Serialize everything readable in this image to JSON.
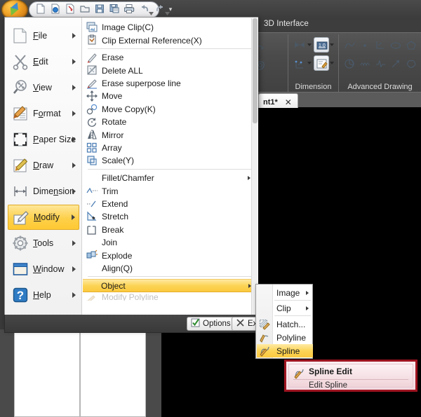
{
  "app": {
    "logo_name": "application-logo",
    "quick_access": [
      {
        "name": "new-file-icon",
        "label": "New"
      },
      {
        "name": "open-image-icon",
        "label": "Open Image"
      },
      {
        "name": "import-icon",
        "label": "Import"
      },
      {
        "name": "open-folder-icon",
        "label": "Open"
      },
      {
        "name": "save-icon",
        "label": "Save"
      },
      {
        "name": "save-as-icon",
        "label": "Save As"
      },
      {
        "name": "print-icon",
        "label": "Print"
      },
      {
        "name": "undo-icon",
        "label": "Undo"
      },
      {
        "name": "redo-icon",
        "label": "Redo"
      }
    ],
    "quick_access_more": "▾"
  },
  "ribbon": {
    "tab_label": "3D Interface",
    "panels": [
      {
        "name": "panel-unnamed",
        "title": ""
      },
      {
        "name": "panel-dimension",
        "title": "Dimension"
      },
      {
        "name": "panel-advanced-drawing",
        "title": "Advanced Drawing"
      }
    ]
  },
  "document_tab": {
    "label": "nt1*",
    "close_label": "✕"
  },
  "menu": {
    "categories": [
      {
        "name": "file",
        "label": "File",
        "pre": "",
        "key": "F",
        "post": "ile",
        "icon": "document-icon",
        "arrow": true,
        "selected": false
      },
      {
        "name": "edit",
        "label": "Edit",
        "pre": "",
        "key": "E",
        "post": "dit",
        "icon": "scissors-icon",
        "arrow": true,
        "selected": false
      },
      {
        "name": "view",
        "label": "View",
        "pre": "",
        "key": "V",
        "post": "iew",
        "icon": "magnifier-icon",
        "arrow": true,
        "selected": false
      },
      {
        "name": "format",
        "label": "Format",
        "pre": "F",
        "key": "o",
        "post": "rmat",
        "icon": "format-brush-icon",
        "arrow": true,
        "selected": false
      },
      {
        "name": "paper-size",
        "label": "Paper Size",
        "pre": "",
        "key": "P",
        "post": "aper Size",
        "icon": "paper-size-icon",
        "arrow": true,
        "selected": false
      },
      {
        "name": "draw",
        "label": "Draw",
        "pre": "",
        "key": "D",
        "post": "raw",
        "icon": "pencil-icon",
        "arrow": true,
        "selected": false
      },
      {
        "name": "dimension",
        "label": "Dimension",
        "pre": "Dime",
        "key": "n",
        "post": "sion",
        "icon": "dimension-icon",
        "arrow": true,
        "selected": false
      },
      {
        "name": "modify",
        "label": "Modify",
        "pre": "",
        "key": "M",
        "post": "odify",
        "icon": "modify-icon",
        "arrow": true,
        "selected": true
      },
      {
        "name": "tools",
        "label": "Tools",
        "pre": "",
        "key": "T",
        "post": "ools",
        "icon": "gear-icon",
        "arrow": true,
        "selected": false
      },
      {
        "name": "window",
        "label": "Window",
        "pre": "",
        "key": "W",
        "post": "indow",
        "icon": "window-icon",
        "arrow": true,
        "selected": false
      },
      {
        "name": "help",
        "label": "Help",
        "pre": "",
        "key": "H",
        "post": "elp",
        "icon": "help-icon",
        "arrow": true,
        "selected": false
      }
    ],
    "items": [
      {
        "name": "image-clip",
        "label": "Image Clip(C)",
        "icon": "image-clip-icon",
        "arrow": false,
        "highlighted": false,
        "sep_after": false
      },
      {
        "name": "clip-external-reference",
        "label": "Clip External Reference(X)",
        "icon": "clip-xref-icon",
        "arrow": false,
        "highlighted": false,
        "sep_after": true
      },
      {
        "name": "erase",
        "label": "Erase",
        "icon": "eraser-icon",
        "arrow": false,
        "highlighted": false,
        "sep_after": false
      },
      {
        "name": "delete-all",
        "label": "Delete ALL",
        "icon": "delete-all-icon",
        "arrow": false,
        "highlighted": false,
        "sep_after": false
      },
      {
        "name": "erase-superpose-line",
        "label": "Erase superpose line",
        "icon": "eraser-line-icon",
        "arrow": false,
        "highlighted": false,
        "sep_after": false
      },
      {
        "name": "move",
        "label": "Move",
        "icon": "move-icon",
        "arrow": false,
        "highlighted": false,
        "sep_after": false
      },
      {
        "name": "move-copy",
        "label": "Move Copy(K)",
        "icon": "move-copy-icon",
        "arrow": false,
        "highlighted": false,
        "sep_after": false
      },
      {
        "name": "rotate",
        "label": "Rotate",
        "icon": "rotate-icon",
        "arrow": false,
        "highlighted": false,
        "sep_after": false
      },
      {
        "name": "mirror",
        "label": "Mirror",
        "icon": "mirror-icon",
        "arrow": false,
        "highlighted": false,
        "sep_after": false
      },
      {
        "name": "array",
        "label": "Array",
        "icon": "array-icon",
        "arrow": false,
        "highlighted": false,
        "sep_after": false
      },
      {
        "name": "scale",
        "label": "Scale(Y)",
        "icon": "scale-icon",
        "arrow": false,
        "highlighted": false,
        "sep_after": true
      },
      {
        "name": "fillet-chamfer",
        "label": "Fillet/Chamfer",
        "icon": "",
        "arrow": true,
        "highlighted": false,
        "sep_after": false
      },
      {
        "name": "trim",
        "label": "Trim",
        "icon": "trim-icon",
        "arrow": false,
        "highlighted": false,
        "sep_after": false
      },
      {
        "name": "extend",
        "label": "Extend",
        "icon": "extend-icon",
        "arrow": false,
        "highlighted": false,
        "sep_after": false
      },
      {
        "name": "stretch",
        "label": "Stretch",
        "icon": "stretch-icon",
        "arrow": false,
        "highlighted": false,
        "sep_after": false
      },
      {
        "name": "break",
        "label": "Break",
        "icon": "break-icon",
        "arrow": false,
        "highlighted": false,
        "sep_after": false
      },
      {
        "name": "join",
        "label": "Join",
        "icon": "",
        "arrow": false,
        "highlighted": false,
        "sep_after": false
      },
      {
        "name": "explode",
        "label": "Explode",
        "icon": "explode-icon",
        "arrow": false,
        "highlighted": false,
        "sep_after": false
      },
      {
        "name": "align",
        "label": "Align(Q)",
        "icon": "",
        "arrow": false,
        "highlighted": false,
        "sep_after": true
      },
      {
        "name": "object",
        "label": "Object",
        "icon": "",
        "arrow": true,
        "highlighted": true,
        "sep_after": false
      }
    ],
    "scroll_down_glyph": "▾",
    "footer": {
      "options_label": "Options",
      "options_icon": "checkbox-icon",
      "exit_label": "Exit",
      "exit_icon": "close-x-icon"
    }
  },
  "submenu": {
    "name": "object-submenu",
    "items": [
      {
        "name": "image",
        "label": "Image",
        "icon": "",
        "arrow": true,
        "highlighted": false,
        "sep_after": true
      },
      {
        "name": "clip",
        "label": "Clip",
        "icon": "",
        "arrow": true,
        "highlighted": false,
        "sep_after": true
      },
      {
        "name": "hatch",
        "label": "Hatch...",
        "icon": "hatch-icon",
        "arrow": false,
        "highlighted": false,
        "sep_after": false
      },
      {
        "name": "polyline",
        "label": "Polyline",
        "icon": "polyline-icon",
        "arrow": false,
        "highlighted": false,
        "sep_after": false
      },
      {
        "name": "spline",
        "label": "Spline",
        "icon": "spline-icon",
        "arrow": false,
        "highlighted": true,
        "sep_after": false
      }
    ]
  },
  "tooltip": {
    "name": "spline-edit-tooltip",
    "icon": "spline-icon",
    "title": "Spline Edit",
    "description": "Edit Spline"
  },
  "colors": {
    "highlight_gold": "#fbc93f",
    "tooltip_border_red": "#9d1420",
    "canvas_black": "#000000",
    "chrome_dark": "#3a3a3a"
  }
}
